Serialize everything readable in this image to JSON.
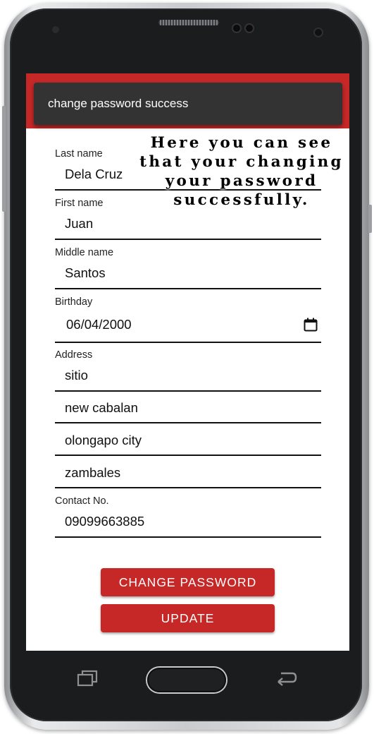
{
  "snackbar": {
    "message": "change password success"
  },
  "annotation": {
    "lines": [
      "Here you can see",
      "that your changing",
      "your password",
      "successfully."
    ]
  },
  "form": {
    "last_name": {
      "label": "Last name",
      "value": "Dela Cruz"
    },
    "first_name": {
      "label": "First name",
      "value": "Juan"
    },
    "middle_name": {
      "label": "Middle name",
      "value": "Santos"
    },
    "birthday": {
      "label": "Birthday",
      "value": "06/04/2000"
    },
    "address": {
      "label": "Address",
      "lines": [
        "sitio",
        "new cabalan",
        "olongapo city",
        "zambales"
      ]
    },
    "contact": {
      "label": "Contact No.",
      "value": "09099663885"
    }
  },
  "buttons": {
    "change_password": "CHANGE PASSWORD",
    "update": "UPDATE"
  },
  "icons": {
    "birthday_picker": "calendar-icon",
    "nav_recents": "recent-apps-icon",
    "nav_home": "home-button",
    "nav_back": "back-arrow-icon"
  },
  "colors": {
    "accent": "#c62828",
    "snackbar": "#333333"
  }
}
